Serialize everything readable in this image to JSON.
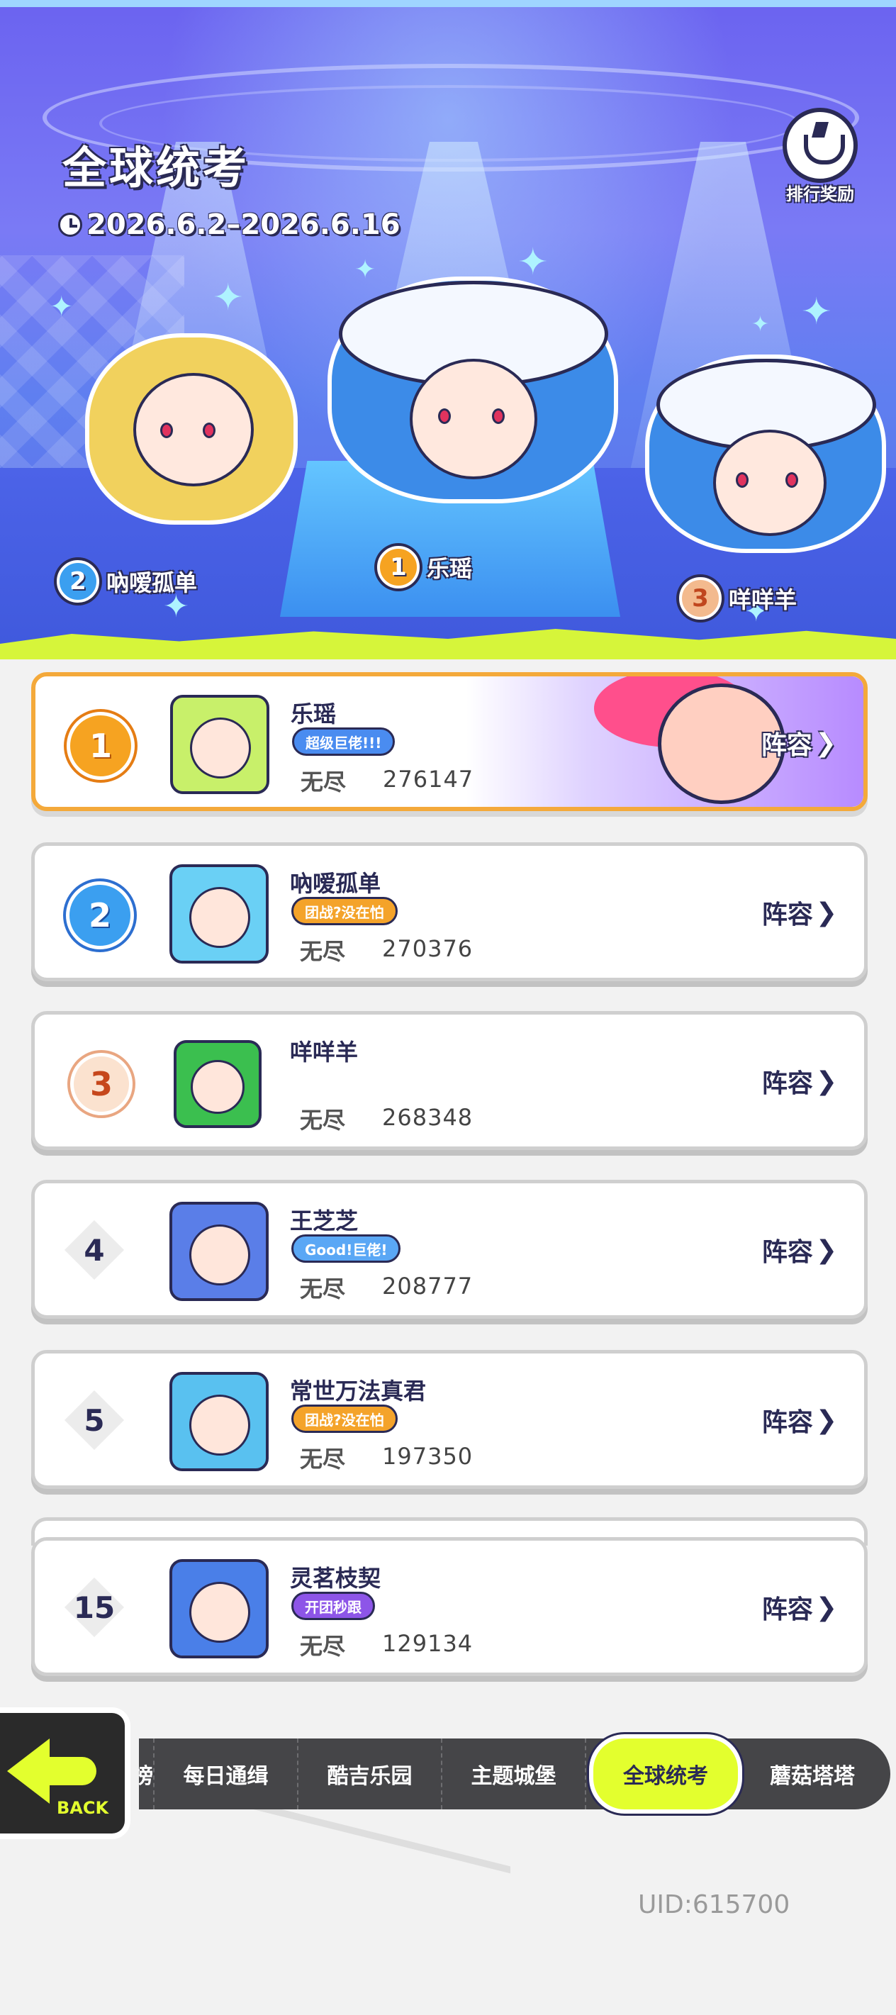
{
  "header": {
    "title": "全球统考",
    "date_range": "2026.6.2–2026.6.16",
    "reward_label": "排行奖励"
  },
  "podium": [
    {
      "rank": "1",
      "name": "乐瑶"
    },
    {
      "rank": "2",
      "name": "吶嗳孤单"
    },
    {
      "rank": "3",
      "name": "咩咩羊"
    }
  ],
  "lineup_label": "阵容",
  "rows": [
    {
      "rank": "1",
      "name": "乐瑶",
      "tag": "超级巨佬!!!",
      "tag_color": "#4a8cf0",
      "mode": "无尽",
      "score": "276147"
    },
    {
      "rank": "2",
      "name": "吶嗳孤单",
      "tag": "团战?没在怕",
      "tag_color": "#f4a32a",
      "mode": "无尽",
      "score": "270376"
    },
    {
      "rank": "3",
      "name": "咩咩羊",
      "tag": "",
      "tag_color": "",
      "mode": "无尽",
      "score": "268348"
    },
    {
      "rank": "4",
      "name": "王芝芝",
      "tag": "Good!巨佬!",
      "tag_color": "#5aa7f5",
      "mode": "无尽",
      "score": "208777"
    },
    {
      "rank": "5",
      "name": "常世万法真君",
      "tag": "团战?没在怕",
      "tag_color": "#f4a32a",
      "mode": "无尽",
      "score": "197350"
    },
    {
      "rank": "15",
      "name": "灵茗枝契",
      "tag": "开团秒跟",
      "tag_color": "#8d55e8",
      "mode": "无尽",
      "score": "129134"
    }
  ],
  "nav": {
    "back_label": "BACK",
    "tabs": [
      "榜",
      "每日通缉",
      "酷吉乐园",
      "主题城堡",
      "全球统考",
      "蘑菇塔塔"
    ],
    "active": "全球统考"
  },
  "uid": "UID:615700",
  "colors": {
    "accent": "#e3ff2e",
    "stage_bg": "#6b63f0",
    "gold": "#f6a321",
    "first_border": "#f4a93a"
  }
}
